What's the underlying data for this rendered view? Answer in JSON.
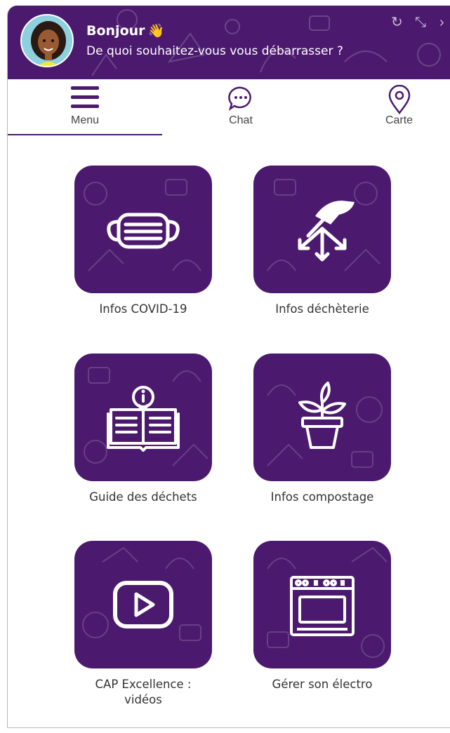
{
  "header": {
    "greeting": "Bonjour",
    "greeting_emoji": "👋",
    "question": "De quoi souhaitez-vous vous débarrasser ?",
    "controls": [
      "↻",
      "⤡",
      "›"
    ]
  },
  "tabs": [
    {
      "label": "Menu",
      "icon": "hamburger-icon",
      "active": true
    },
    {
      "label": "Chat",
      "icon": "chat-bubble-icon",
      "active": false
    },
    {
      "label": "Carte",
      "icon": "map-pin-icon",
      "active": false
    }
  ],
  "tiles": [
    {
      "label": "Infos COVID-19",
      "icon": "face-mask-icon"
    },
    {
      "label": "Infos déchèterie",
      "icon": "drop-off-hand-icon"
    },
    {
      "label": "Guide des déchets",
      "icon": "info-book-icon"
    },
    {
      "label": "Infos compostage",
      "icon": "plant-pot-icon"
    },
    {
      "label": "CAP Excellence : vidéos",
      "icon": "video-play-icon"
    },
    {
      "label": "Gérer son électro",
      "icon": "oven-icon"
    }
  ],
  "colors": {
    "brand": "#4b1a6e",
    "text": "#333333",
    "background": "#ffffff"
  }
}
